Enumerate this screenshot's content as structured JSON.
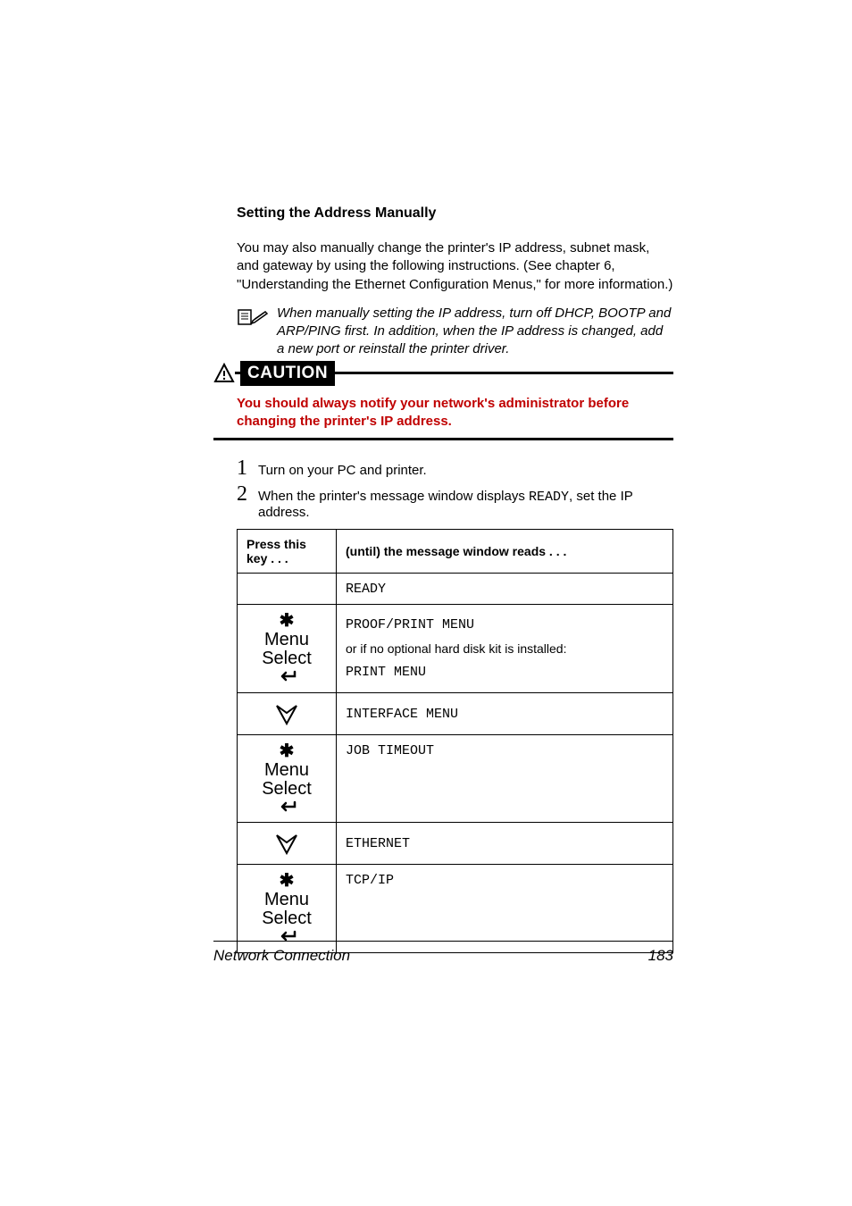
{
  "heading": "Setting the Address Manually",
  "intro": "You may also manually change the printer's IP address, subnet mask, and gateway by using the following instructions. (See chapter 6, \"Understanding the Ethernet Configuration Menus,\" for more information.)",
  "note": "When manually setting the IP address, turn off DHCP, BOOTP and ARP/PING first. In addition, when the IP address is changed, add a new port or reinstall the printer driver.",
  "caution_label": "CAUTION",
  "caution_text": "You should always notify your network's administrator before changing the printer's IP address.",
  "steps": {
    "s1_num": "1",
    "s1_text": "Turn on your PC and printer.",
    "s2_num": "2",
    "s2_text_a": "When the printer's message window displays ",
    "s2_text_mono": "READY",
    "s2_text_b": ", set the IP address."
  },
  "table": {
    "h1": "Press this key . . .",
    "h2": "(until) the message window reads  . . .",
    "r0": "READY",
    "r1_a": "PROOF/PRINT MENU",
    "r1_b": "or if no optional hard disk kit is installed:",
    "r1_c": "PRINT MENU",
    "r2": "INTERFACE MENU",
    "r3": "JOB TIMEOUT",
    "r4": "ETHERNET",
    "r5": "TCP/IP",
    "key_menu": "Menu",
    "key_select": "Select"
  },
  "footer": {
    "title": "Network Connection",
    "page": "183"
  }
}
